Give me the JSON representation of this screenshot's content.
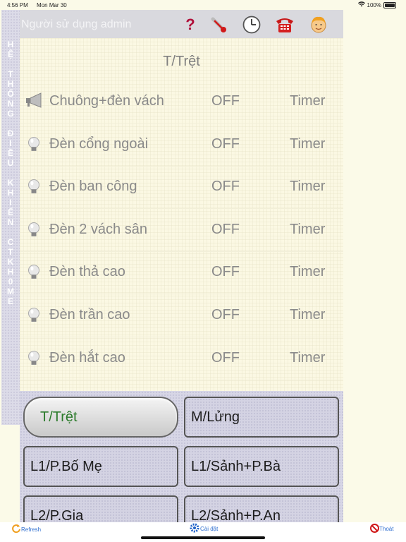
{
  "status_bar": {
    "time": "4:56 PM",
    "date": "Mon Mar 30",
    "battery": "100%"
  },
  "sidebar_letters": [
    "H",
    "Ệ",
    " ",
    "T",
    "H",
    "Ố",
    "N",
    "G",
    " ",
    "Đ",
    "I",
    "Ề",
    "U",
    " ",
    "K",
    "H",
    "I",
    "Ể",
    "N",
    " ",
    "C",
    "T",
    "K",
    "H",
    "0",
    "M",
    "E"
  ],
  "top_bar": {
    "user_label": "Người sử dụng admin",
    "icons": [
      "help-icon",
      "thermometer-icon",
      "clock-icon",
      "phone-icon",
      "avatar-icon"
    ]
  },
  "room": {
    "title": "T/Trệt",
    "devices": [
      {
        "name": "Chuông+đèn vách",
        "state": "OFF",
        "timer": "Timer",
        "icon": "speaker-icon"
      },
      {
        "name": "Đèn cổng ngoài",
        "state": "OFF",
        "timer": "Timer",
        "icon": "bulb-icon"
      },
      {
        "name": "Đèn ban công",
        "state": "OFF",
        "timer": "Timer",
        "icon": "bulb-icon"
      },
      {
        "name": "Đèn 2 vách sân",
        "state": "OFF",
        "timer": "Timer",
        "icon": "bulb-icon"
      },
      {
        "name": "Đèn thả cao",
        "state": "OFF",
        "timer": "Timer",
        "icon": "bulb-icon"
      },
      {
        "name": "Đèn trần cao",
        "state": "OFF",
        "timer": "Timer",
        "icon": "bulb-icon"
      },
      {
        "name": "Đèn hắt cao",
        "state": "OFF",
        "timer": "Timer",
        "icon": "bulb-icon"
      }
    ]
  },
  "room_buttons": [
    {
      "label": "T/Trệt",
      "active": true
    },
    {
      "label": "M/Lửng",
      "active": false
    },
    {
      "label": "L1/P.Bố Mẹ",
      "active": false
    },
    {
      "label": "L1/Sảnh+P.Bà",
      "active": false
    },
    {
      "label": "L2/P.Gia",
      "active": false
    },
    {
      "label": "L2/Sảnh+P.An",
      "active": false
    }
  ],
  "bottom_bar": {
    "refresh": "Refresh",
    "settings": "Cài đặt",
    "exit": "Thoát"
  }
}
